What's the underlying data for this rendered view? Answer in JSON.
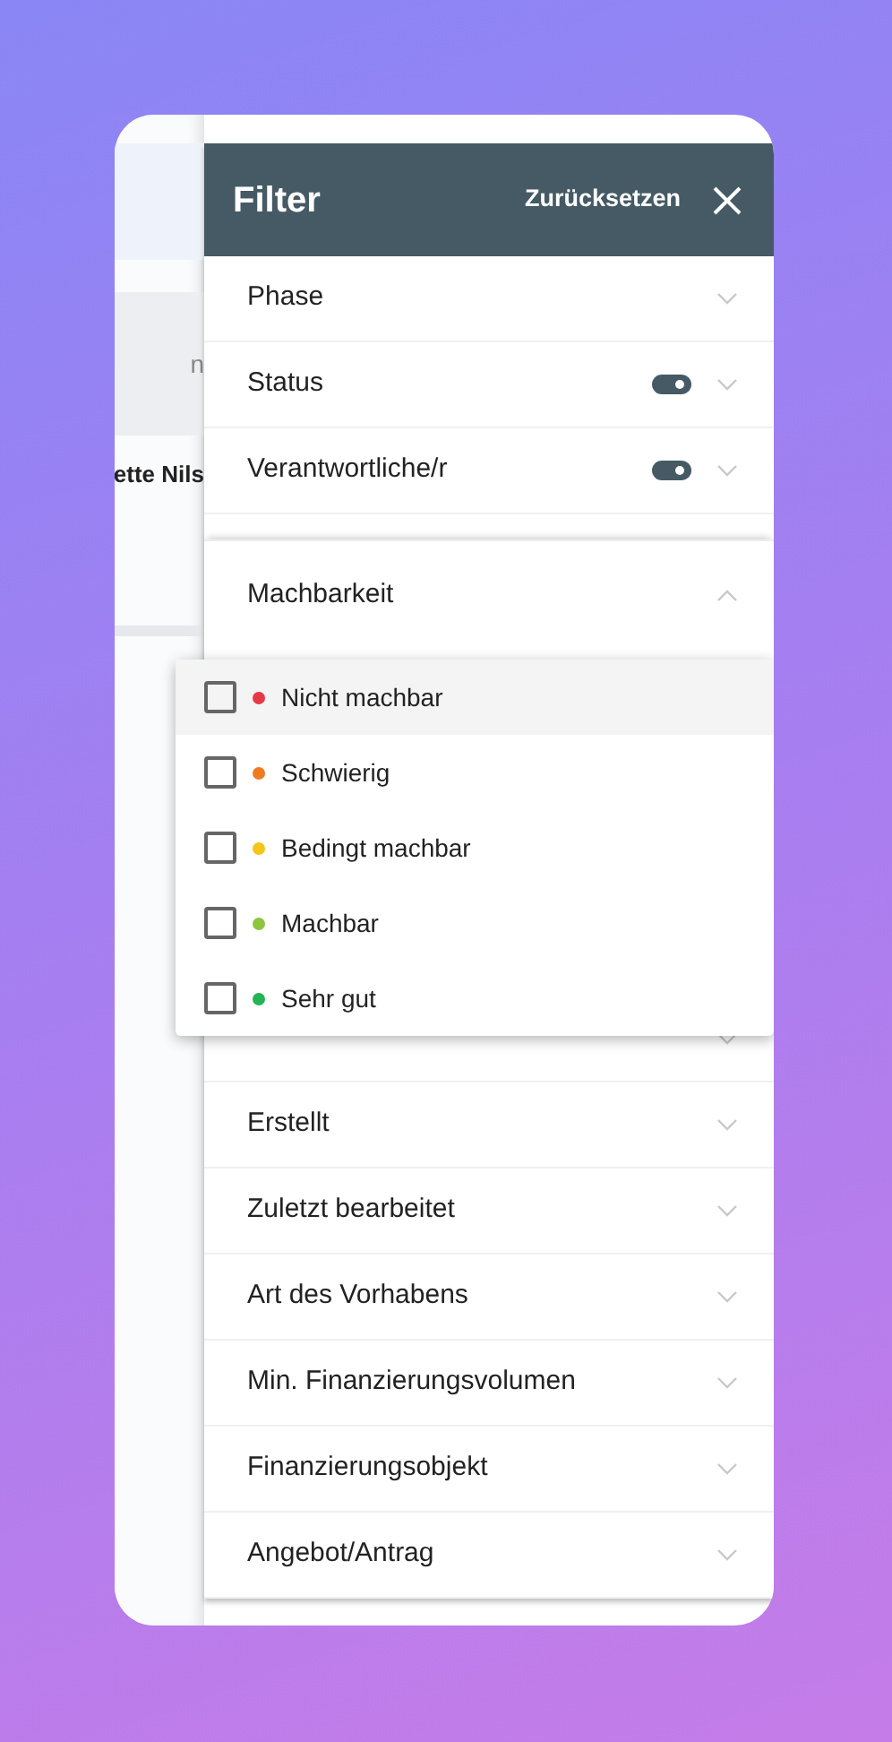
{
  "background_app": {
    "field_text": "n",
    "name_text": "ette Nils"
  },
  "filter": {
    "title": "Filter",
    "reset": "Zurücksetzen",
    "sections": [
      {
        "label": "Phase",
        "expanded": false
      },
      {
        "label": "Status",
        "expanded": false,
        "on": true
      },
      {
        "label": "Verantwortliche/r",
        "expanded": false,
        "on": true
      },
      {
        "label": "Machbarkeit",
        "expanded": true,
        "options": [
          {
            "label": "Nicht machbar",
            "checked": false,
            "highlighted": true,
            "color": "#e53945"
          },
          {
            "label": "Schwierig",
            "checked": false,
            "highlighted": false,
            "color": "#f07a22"
          },
          {
            "label": "Bedingt machbar",
            "checked": false,
            "highlighted": false,
            "color": "#f5c518"
          },
          {
            "label": "Machbar",
            "checked": false,
            "highlighted": false,
            "color": "#8cc63f"
          },
          {
            "label": "Sehr gut",
            "checked": false,
            "highlighted": false,
            "color": "#22b455"
          }
        ]
      },
      {
        "expanded": false
      },
      {
        "label": "Erstellt",
        "expanded": false
      },
      {
        "label": "Zuletzt bearbeitet",
        "expanded": false
      },
      {
        "label": "Art des Vorhabens",
        "expanded": false
      },
      {
        "label": "Min. Finanzierungsvolumen",
        "expanded": false
      },
      {
        "label": "Finanzierungsobjekt",
        "expanded": false
      },
      {
        "label": "Angebot/Antrag",
        "expanded": false
      }
    ]
  }
}
